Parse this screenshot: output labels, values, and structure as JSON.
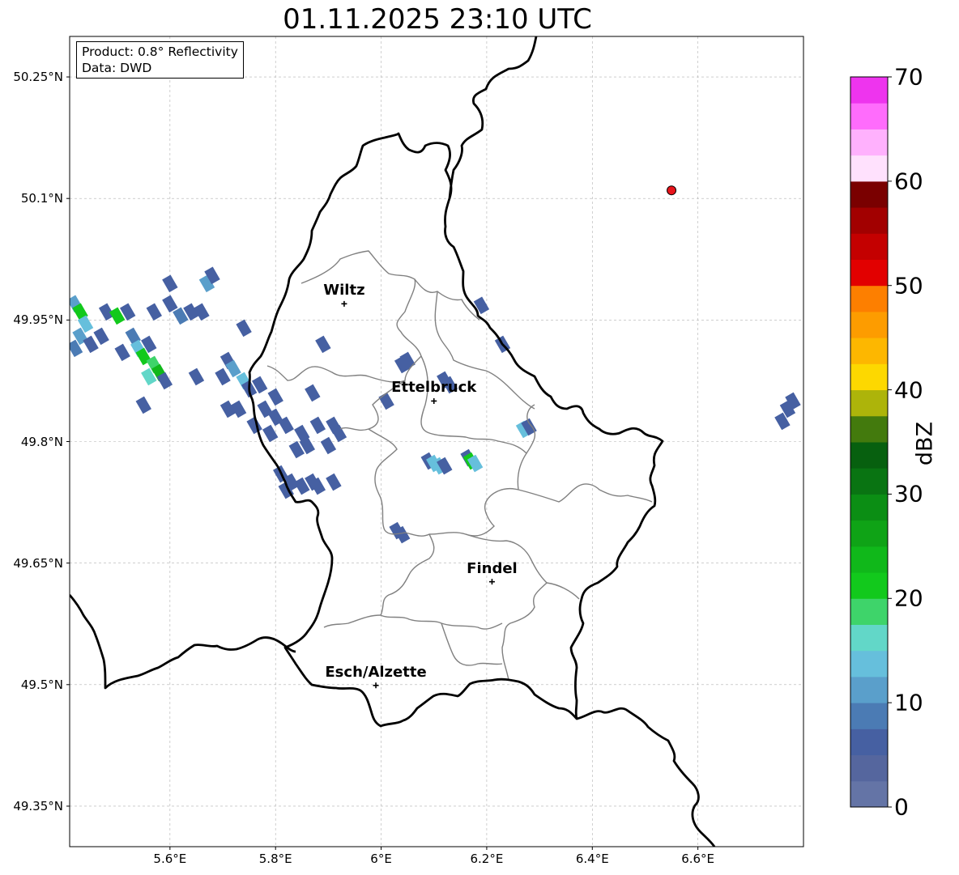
{
  "title": "01.11.2025 23:10 UTC",
  "info": {
    "product": "Product: 0.8° Reflectivity",
    "data": "Data: DWD"
  },
  "axes": {
    "lat_labels": [
      "50.25°N",
      "50.1°N",
      "49.95°N",
      "49.8°N",
      "49.65°N",
      "49.5°N",
      "49.35°N"
    ],
    "lat_values": [
      50.25,
      50.1,
      49.95,
      49.8,
      49.65,
      49.5,
      49.35
    ],
    "lon_labels": [
      "5.6°E",
      "5.8°E",
      "6°E",
      "6.2°E",
      "6.4°E",
      "6.6°E"
    ],
    "lon_values": [
      5.6,
      5.8,
      6.0,
      6.2,
      6.4,
      6.6
    ],
    "lon_range": [
      5.41,
      6.8
    ],
    "lat_range": [
      49.3,
      50.3
    ]
  },
  "cities": [
    {
      "name": "Wiltz",
      "lon": 5.93,
      "lat": 49.97
    },
    {
      "name": "Ettelbruck",
      "lon": 6.1,
      "lat": 49.85
    },
    {
      "name": "Findel",
      "lon": 6.21,
      "lat": 49.627
    },
    {
      "name": "Esch/Alzette",
      "lon": 5.99,
      "lat": 49.499
    }
  ],
  "radar_site": {
    "lon": 6.55,
    "lat": 50.11,
    "color": "#e8141b"
  },
  "colorbar": {
    "label": "dBZ",
    "min": 0,
    "max": 70,
    "ticks": [
      "0",
      "10",
      "20",
      "30",
      "40",
      "50",
      "60",
      "70"
    ],
    "colors": [
      "#6474a6",
      "#55669e",
      "#4660a2",
      "#4b7bb4",
      "#5a9fcb",
      "#66bfdc",
      "#62d7c8",
      "#3ed46a",
      "#12c91c",
      "#10b81a",
      "#0fa316",
      "#0b8e14",
      "#097412",
      "#07600f",
      "#437a0d",
      "#adb40a",
      "#fdd800",
      "#fdb700",
      "#fd9c00",
      "#fd7f00",
      "#e20000",
      "#c40000",
      "#a20000",
      "#7a0000",
      "#ffe1fd",
      "#ffb1fd",
      "#ff6cfc",
      "#ee34ee"
    ]
  },
  "echoes": [
    {
      "lon": 5.42,
      "lat": 49.97,
      "dbz": 12
    },
    {
      "lon": 5.43,
      "lat": 49.96,
      "dbz": 22
    },
    {
      "lon": 5.44,
      "lat": 49.945,
      "dbz": 14
    },
    {
      "lon": 5.43,
      "lat": 49.93,
      "dbz": 10
    },
    {
      "lon": 5.45,
      "lat": 49.92,
      "dbz": 6
    },
    {
      "lon": 5.42,
      "lat": 49.915,
      "dbz": 8
    },
    {
      "lon": 5.48,
      "lat": 49.96,
      "dbz": 6
    },
    {
      "lon": 5.5,
      "lat": 49.955,
      "dbz": 20
    },
    {
      "lon": 5.52,
      "lat": 49.96,
      "dbz": 6
    },
    {
      "lon": 5.47,
      "lat": 49.93,
      "dbz": 6
    },
    {
      "lon": 5.53,
      "lat": 49.93,
      "dbz": 8
    },
    {
      "lon": 5.54,
      "lat": 49.915,
      "dbz": 13
    },
    {
      "lon": 5.55,
      "lat": 49.905,
      "dbz": 22
    },
    {
      "lon": 5.56,
      "lat": 49.92,
      "dbz": 6
    },
    {
      "lon": 5.57,
      "lat": 49.895,
      "dbz": 18
    },
    {
      "lon": 5.58,
      "lat": 49.885,
      "dbz": 23
    },
    {
      "lon": 5.59,
      "lat": 49.875,
      "dbz": 7
    },
    {
      "lon": 5.56,
      "lat": 49.88,
      "dbz": 15
    },
    {
      "lon": 5.51,
      "lat": 49.91,
      "dbz": 6
    },
    {
      "lon": 5.55,
      "lat": 49.845,
      "dbz": 6
    },
    {
      "lon": 5.57,
      "lat": 49.96,
      "dbz": 6
    },
    {
      "lon": 5.6,
      "lat": 49.97,
      "dbz": 6
    },
    {
      "lon": 5.62,
      "lat": 49.955,
      "dbz": 8
    },
    {
      "lon": 5.64,
      "lat": 49.96,
      "dbz": 6
    },
    {
      "lon": 5.66,
      "lat": 49.96,
      "dbz": 6
    },
    {
      "lon": 5.6,
      "lat": 49.995,
      "dbz": 6
    },
    {
      "lon": 5.67,
      "lat": 49.995,
      "dbz": 10
    },
    {
      "lon": 5.68,
      "lat": 50.005,
      "dbz": 6
    },
    {
      "lon": 5.65,
      "lat": 49.88,
      "dbz": 6
    },
    {
      "lon": 5.71,
      "lat": 49.9,
      "dbz": 6
    },
    {
      "lon": 5.72,
      "lat": 49.89,
      "dbz": 12
    },
    {
      "lon": 5.74,
      "lat": 49.875,
      "dbz": 14
    },
    {
      "lon": 5.75,
      "lat": 49.865,
      "dbz": 6
    },
    {
      "lon": 5.7,
      "lat": 49.88,
      "dbz": 6
    },
    {
      "lon": 5.73,
      "lat": 49.84,
      "dbz": 6
    },
    {
      "lon": 5.71,
      "lat": 49.84,
      "dbz": 6
    },
    {
      "lon": 5.74,
      "lat": 49.94,
      "dbz": 6
    },
    {
      "lon": 5.77,
      "lat": 49.87,
      "dbz": 6
    },
    {
      "lon": 5.78,
      "lat": 49.84,
      "dbz": 6
    },
    {
      "lon": 5.8,
      "lat": 49.83,
      "dbz": 6
    },
    {
      "lon": 5.82,
      "lat": 49.82,
      "dbz": 6
    },
    {
      "lon": 5.79,
      "lat": 49.81,
      "dbz": 6
    },
    {
      "lon": 5.76,
      "lat": 49.82,
      "dbz": 6
    },
    {
      "lon": 5.8,
      "lat": 49.855,
      "dbz": 6
    },
    {
      "lon": 5.85,
      "lat": 49.81,
      "dbz": 6
    },
    {
      "lon": 5.86,
      "lat": 49.795,
      "dbz": 6
    },
    {
      "lon": 5.84,
      "lat": 49.79,
      "dbz": 6
    },
    {
      "lon": 5.88,
      "lat": 49.82,
      "dbz": 6
    },
    {
      "lon": 5.9,
      "lat": 49.795,
      "dbz": 6
    },
    {
      "lon": 5.81,
      "lat": 49.76,
      "dbz": 6
    },
    {
      "lon": 5.83,
      "lat": 49.75,
      "dbz": 6
    },
    {
      "lon": 5.85,
      "lat": 49.745,
      "dbz": 6
    },
    {
      "lon": 5.82,
      "lat": 49.74,
      "dbz": 6
    },
    {
      "lon": 5.87,
      "lat": 49.75,
      "dbz": 6
    },
    {
      "lon": 5.88,
      "lat": 49.745,
      "dbz": 6
    },
    {
      "lon": 5.91,
      "lat": 49.82,
      "dbz": 6
    },
    {
      "lon": 5.92,
      "lat": 49.81,
      "dbz": 6
    },
    {
      "lon": 5.89,
      "lat": 49.92,
      "dbz": 6
    },
    {
      "lon": 5.87,
      "lat": 49.86,
      "dbz": 6
    },
    {
      "lon": 6.04,
      "lat": 49.895,
      "dbz": 6
    },
    {
      "lon": 6.05,
      "lat": 49.9,
      "dbz": 6
    },
    {
      "lon": 6.01,
      "lat": 49.85,
      "dbz": 6
    },
    {
      "lon": 6.12,
      "lat": 49.876,
      "dbz": 6
    },
    {
      "lon": 6.13,
      "lat": 49.87,
      "dbz": 6
    },
    {
      "lon": 6.09,
      "lat": 49.776,
      "dbz": 6
    },
    {
      "lon": 6.1,
      "lat": 49.773,
      "dbz": 13
    },
    {
      "lon": 6.11,
      "lat": 49.77,
      "dbz": 14
    },
    {
      "lon": 6.12,
      "lat": 49.77,
      "dbz": 6
    },
    {
      "lon": 6.165,
      "lat": 49.78,
      "dbz": 6
    },
    {
      "lon": 6.17,
      "lat": 49.776,
      "dbz": 22
    },
    {
      "lon": 6.178,
      "lat": 49.773,
      "dbz": 14
    },
    {
      "lon": 6.27,
      "lat": 49.815,
      "dbz": 14
    },
    {
      "lon": 6.28,
      "lat": 49.818,
      "dbz": 6
    },
    {
      "lon": 6.03,
      "lat": 49.69,
      "dbz": 6
    },
    {
      "lon": 6.04,
      "lat": 49.685,
      "dbz": 6
    },
    {
      "lon": 6.78,
      "lat": 49.85,
      "dbz": 6
    },
    {
      "lon": 6.77,
      "lat": 49.84,
      "dbz": 6
    },
    {
      "lon": 6.76,
      "lat": 49.825,
      "dbz": 6
    },
    {
      "lon": 6.19,
      "lat": 49.968,
      "dbz": 6
    },
    {
      "lon": 6.23,
      "lat": 49.92,
      "dbz": 6
    },
    {
      "lon": 5.91,
      "lat": 49.75,
      "dbz": 6
    }
  ]
}
